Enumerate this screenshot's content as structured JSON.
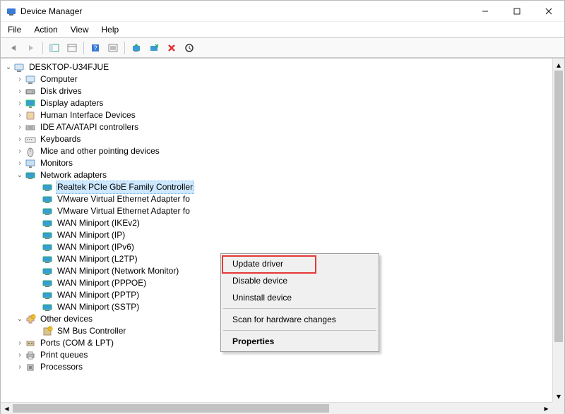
{
  "window": {
    "title": "Device Manager",
    "minimize": "–",
    "maximize": "☐",
    "close": "✕"
  },
  "menu": {
    "file": "File",
    "action": "Action",
    "view": "View",
    "help": "Help"
  },
  "tree": {
    "root": "DESKTOP-U34FJUE",
    "categories": [
      {
        "label": "Computer",
        "icon": "computer"
      },
      {
        "label": "Disk drives",
        "icon": "disk"
      },
      {
        "label": "Display adapters",
        "icon": "display"
      },
      {
        "label": "Human Interface Devices",
        "icon": "hid"
      },
      {
        "label": "IDE ATA/ATAPI controllers",
        "icon": "ide"
      },
      {
        "label": "Keyboards",
        "icon": "keyboard"
      },
      {
        "label": "Mice and other pointing devices",
        "icon": "mouse"
      },
      {
        "label": "Monitors",
        "icon": "monitor"
      }
    ],
    "network": {
      "label": "Network adapters",
      "children": [
        {
          "label": "Realtek PCIe GbE Family Controller",
          "selected": true
        },
        {
          "label": "VMware Virtual Ethernet Adapter fo"
        },
        {
          "label": "VMware Virtual Ethernet Adapter fo"
        },
        {
          "label": "WAN Miniport (IKEv2)"
        },
        {
          "label": "WAN Miniport (IP)"
        },
        {
          "label": "WAN Miniport (IPv6)"
        },
        {
          "label": "WAN Miniport (L2TP)"
        },
        {
          "label": "WAN Miniport (Network Monitor)"
        },
        {
          "label": "WAN Miniport (PPPOE)"
        },
        {
          "label": "WAN Miniport (PPTP)"
        },
        {
          "label": "WAN Miniport (SSTP)"
        }
      ]
    },
    "other": {
      "label": "Other devices",
      "child": "SM Bus Controller"
    },
    "rest": [
      {
        "label": "Ports (COM & LPT)",
        "icon": "port"
      },
      {
        "label": "Print queues",
        "icon": "printer"
      },
      {
        "label": "Processors",
        "icon": "cpu"
      }
    ]
  },
  "context_menu": {
    "update": "Update driver",
    "disable": "Disable device",
    "uninstall": "Uninstall device",
    "scan": "Scan for hardware changes",
    "properties": "Properties"
  }
}
